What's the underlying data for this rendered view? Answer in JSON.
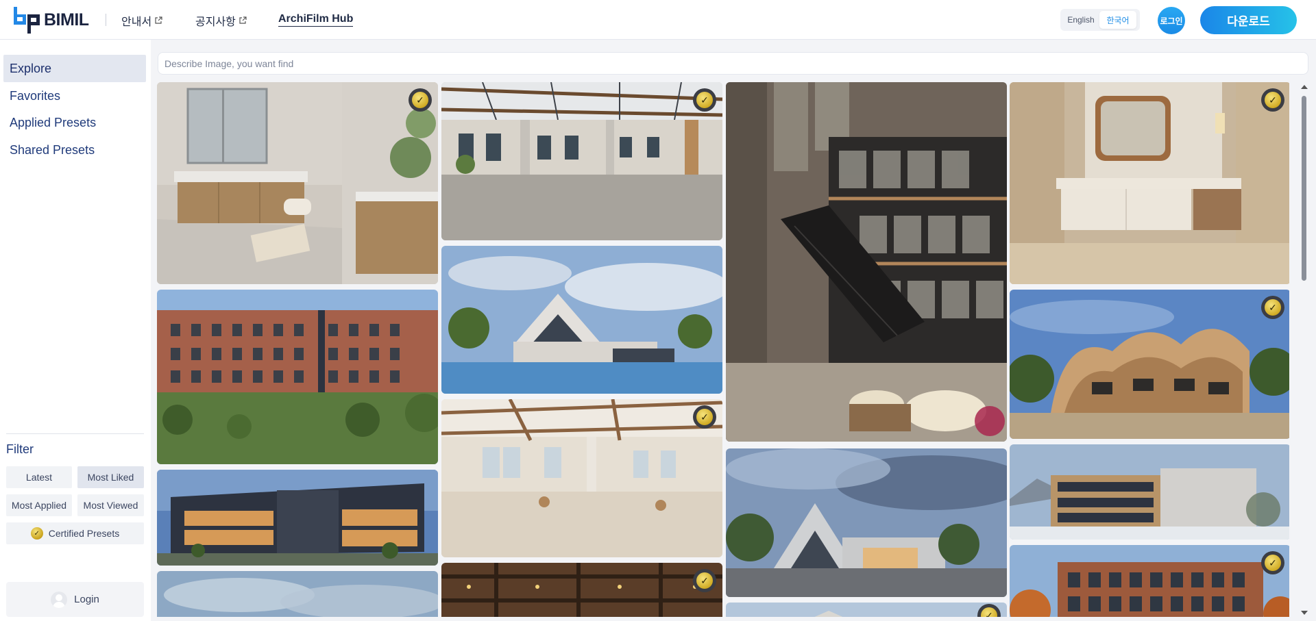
{
  "header": {
    "logo_text": "BIMIL",
    "nav_guide": "안내서",
    "nav_notice": "공지사항",
    "nav_hub": "ArchiFilm Hub",
    "lang_en": "English",
    "lang_ko": "한국어",
    "login_label": "로그인",
    "download_label": "다운로드"
  },
  "sidebar": {
    "items": [
      {
        "label": "Explore",
        "active": true
      },
      {
        "label": "Favorites"
      },
      {
        "label": "Applied Presets"
      },
      {
        "label": "Shared Presets"
      }
    ],
    "filter_title": "Filter",
    "filters": {
      "latest": "Latest",
      "most_liked": "Most Liked",
      "most_applied": "Most Applied",
      "most_viewed": "Most Viewed",
      "certified": "Certified Presets"
    },
    "login_label": "Login"
  },
  "search": {
    "placeholder": "Describe Image, you want find"
  },
  "gallery": {
    "tiles": [
      {
        "scene": "bathroom-interior",
        "certified": true
      },
      {
        "scene": "brick-apartment-exterior",
        "certified": false
      },
      {
        "scene": "glass-office-dusk",
        "certified": false
      },
      {
        "scene": "cloudy-sky",
        "certified": false
      },
      {
        "scene": "industrial-loft-interior",
        "certified": true
      },
      {
        "scene": "lakeside-house",
        "certified": false
      },
      {
        "scene": "loft-cafe-interior",
        "certified": true
      },
      {
        "scene": "timber-warehouse",
        "certified": true
      },
      {
        "scene": "atrium-staircase-lounge",
        "certified": false
      },
      {
        "scene": "gabled-house-dusk",
        "certified": false
      },
      {
        "scene": "partial-tile",
        "certified": true
      },
      {
        "scene": "vanity-bathroom",
        "certified": true
      },
      {
        "scene": "organic-wave-building",
        "certified": true
      },
      {
        "scene": "snowy-campus-building",
        "certified": false
      },
      {
        "scene": "brick-office-autumn",
        "certified": true
      }
    ]
  }
}
